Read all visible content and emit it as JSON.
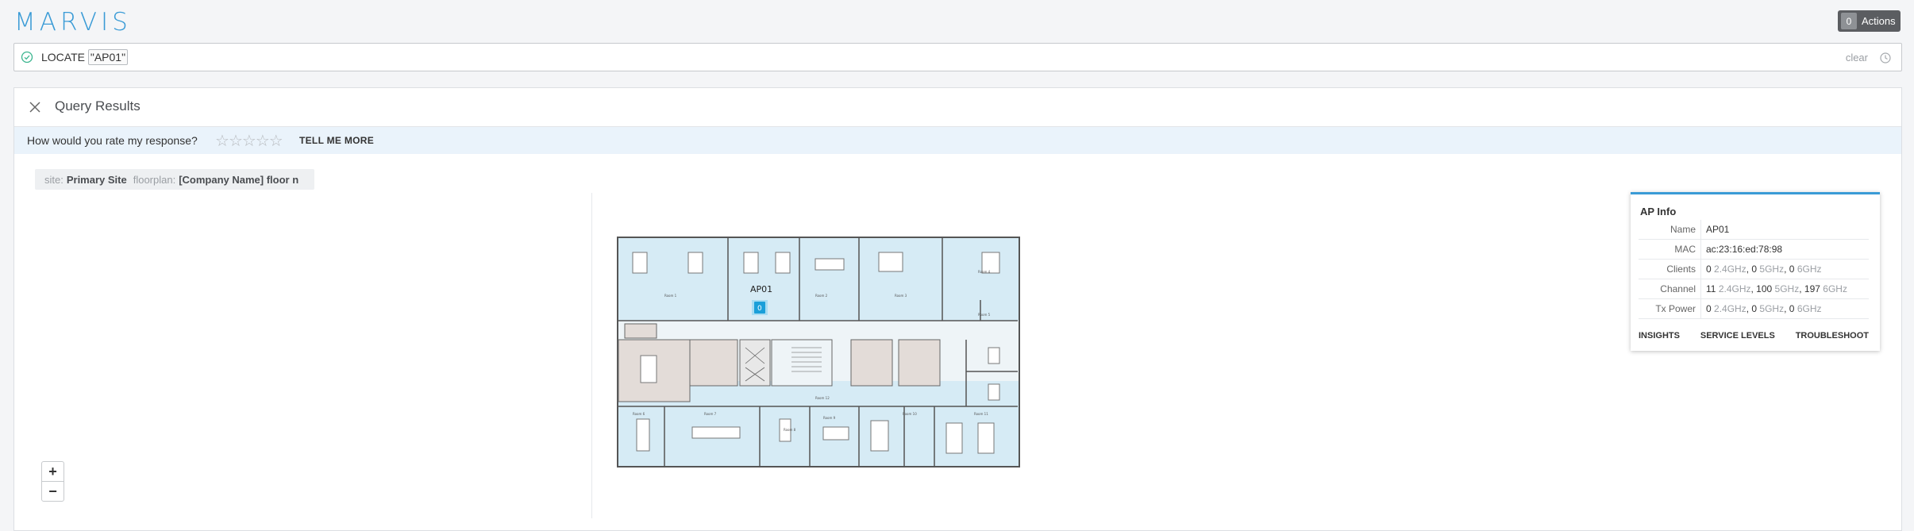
{
  "app": {
    "logo": "MARVIS"
  },
  "actions": {
    "count": "0",
    "label": "Actions"
  },
  "query": {
    "prefix": "LOCATE",
    "token": "\"AP01\"",
    "clear_label": "clear"
  },
  "results": {
    "title": "Query Results",
    "rating_question": "How would you rate my response?",
    "stars": [
      "☆",
      "☆",
      "☆",
      "☆",
      "☆"
    ],
    "tell_more": "TELL ME MORE",
    "context": {
      "site_key": "site:",
      "site_val": "Primary Site",
      "floor_key": "floorplan:",
      "floor_val": "[Company Name] floor n"
    },
    "zoom": {
      "in": "+",
      "out": "−"
    },
    "map": {
      "ap_label": "AP01",
      "ap_count": "0",
      "room_labels": [
        "Room 1",
        "Room 2",
        "Room 3",
        "Room 4",
        "Room 5",
        "Room 6",
        "Room 7",
        "Room 8",
        "Room 9",
        "Room 10",
        "Room 11",
        "Room 12"
      ],
      "colors": {
        "room": "#d6ebf5",
        "core": "#e3dcd8",
        "wall": "#555",
        "ap": "#1a9fd9"
      }
    }
  },
  "ap_info": {
    "title": "AP Info",
    "rows": [
      {
        "key": "Name",
        "value": "AP01"
      },
      {
        "key": "MAC",
        "value": "ac:23:16:ed:78:98"
      },
      {
        "key": "Clients",
        "v1": "0",
        "u1": "2.4GHz",
        "v2": "0",
        "u2": "5GHz",
        "v3": "0",
        "u3": "6GHz"
      },
      {
        "key": "Channel",
        "v1": "11",
        "u1": "2.4GHz",
        "v2": "100",
        "u2": "5GHz",
        "v3": "197",
        "u3": "6GHz"
      },
      {
        "key": "Tx Power",
        "v1": "0",
        "u1": "2.4GHz",
        "v2": "0",
        "u2": "5GHz",
        "v3": "0",
        "u3": "6GHz"
      }
    ],
    "links": [
      "INSIGHTS",
      "SERVICE LEVELS",
      "TROUBLESHOOT"
    ]
  }
}
